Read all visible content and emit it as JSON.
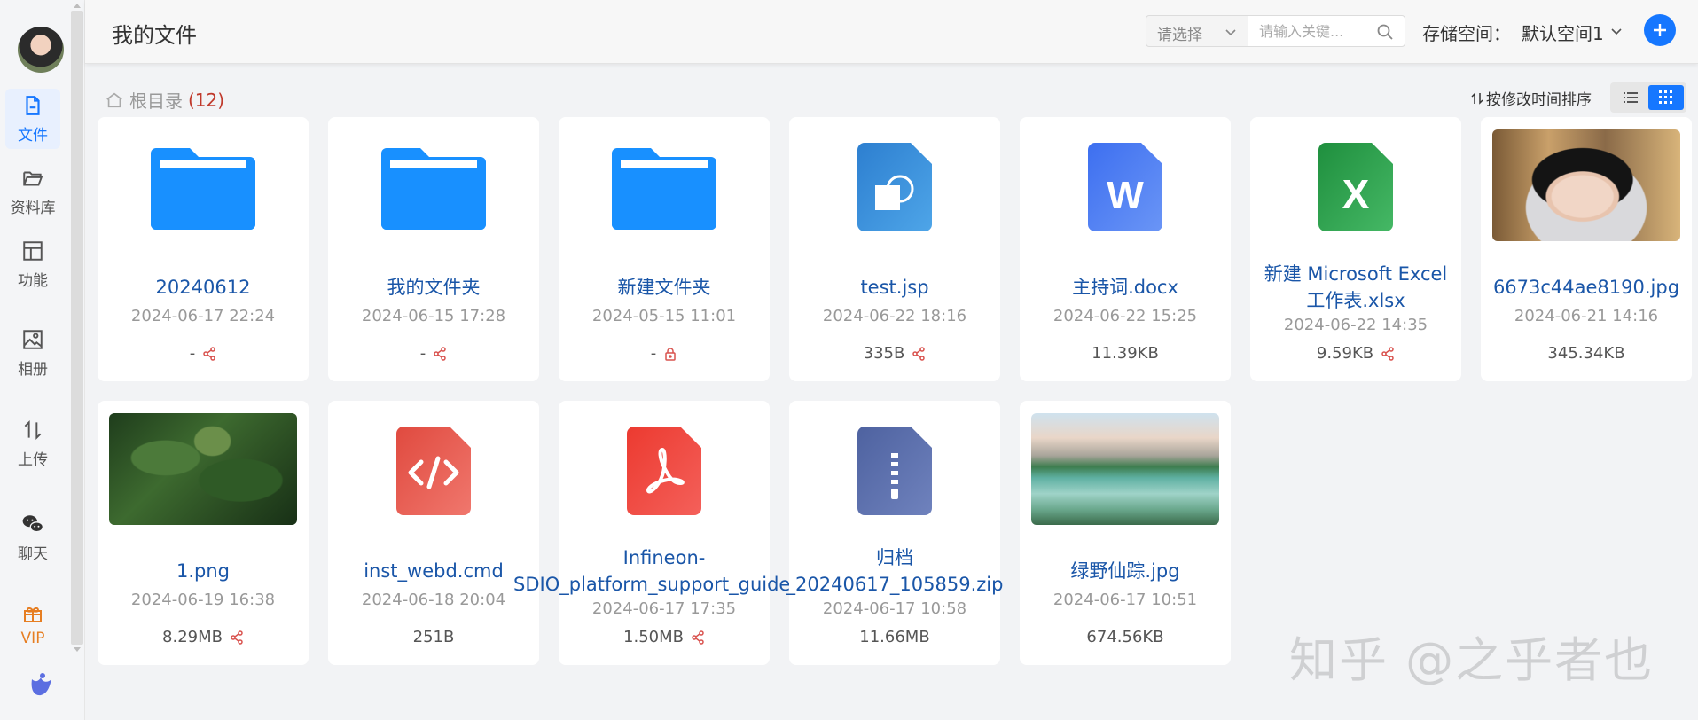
{
  "header": {
    "title": "我的文件",
    "select_placeholder": "请选择",
    "search_placeholder": "请输入关键...",
    "storage_label": "存储空间：",
    "storage_value": "默认空间1"
  },
  "sidebar": {
    "items": [
      {
        "label": "文件",
        "icon": "file-icon",
        "active": true
      },
      {
        "label": "资料库",
        "icon": "folder-open-icon"
      },
      {
        "label": "功能",
        "icon": "layout-icon"
      },
      {
        "label": "相册",
        "icon": "image-icon"
      },
      {
        "label": "上传",
        "icon": "upload-arrows-icon"
      },
      {
        "label": "聊天",
        "icon": "wechat-icon"
      },
      {
        "label": "VIP",
        "icon": "gift-icon"
      }
    ]
  },
  "breadcrumb": {
    "label": "根目录",
    "count": "(12)"
  },
  "sort": {
    "label": "按修改时间排序"
  },
  "colors": {
    "accent": "#1677ff",
    "folder": "#1890ff",
    "word": "#4f7ff3",
    "excel": "#2fa24f",
    "cmd": "#e85a4f",
    "pdf": "#f0453a",
    "zip": "#5b6fa8",
    "jsp": "#3a8fd6",
    "share": "#d9534f"
  },
  "files": [
    {
      "name": "20240612",
      "date": "2024-06-17 22:24",
      "size": "-",
      "type": "folder",
      "badge": "share-icon"
    },
    {
      "name": "我的文件夹",
      "date": "2024-06-15 17:28",
      "size": "-",
      "type": "folder",
      "badge": "share-icon"
    },
    {
      "name": "新建文件夹",
      "date": "2024-05-15 11:01",
      "size": "-",
      "type": "folder",
      "badge": "lock-icon"
    },
    {
      "name": "test.jsp",
      "date": "2024-06-22 18:16",
      "size": "335B",
      "type": "jsp",
      "badge": "share-icon"
    },
    {
      "name": "主持词.docx",
      "date": "2024-06-22 15:25",
      "size": "11.39KB",
      "type": "word",
      "badge": ""
    },
    {
      "name": "新建 Microsoft Excel 工作表.xlsx",
      "date": "2024-06-22 14:35",
      "size": "9.59KB",
      "type": "excel",
      "badge": "share-icon"
    },
    {
      "name": "6673c44ae8190.jpg",
      "date": "2024-06-21 14:16",
      "size": "345.34KB",
      "type": "photo-portrait",
      "badge": ""
    },
    {
      "name": "1.png",
      "date": "2024-06-19 16:38",
      "size": "8.29MB",
      "type": "photo-forest",
      "badge": "share-icon"
    },
    {
      "name": "inst_webd.cmd",
      "date": "2024-06-18 20:04",
      "size": "251B",
      "type": "code",
      "badge": ""
    },
    {
      "name": "Infineon-SDIO_platform_support_guide-...",
      "date": "2024-06-17 17:35",
      "size": "1.50MB",
      "type": "pdf",
      "badge": "share-icon"
    },
    {
      "name": "归档_20240617_105859.zip",
      "date": "2024-06-17 10:58",
      "size": "11.66MB",
      "type": "zip",
      "badge": ""
    },
    {
      "name": "绿野仙踪.jpg",
      "date": "2024-06-17 10:51",
      "size": "674.56KB",
      "type": "photo-lake",
      "badge": ""
    }
  ],
  "watermark": "知乎 @之乎者也"
}
